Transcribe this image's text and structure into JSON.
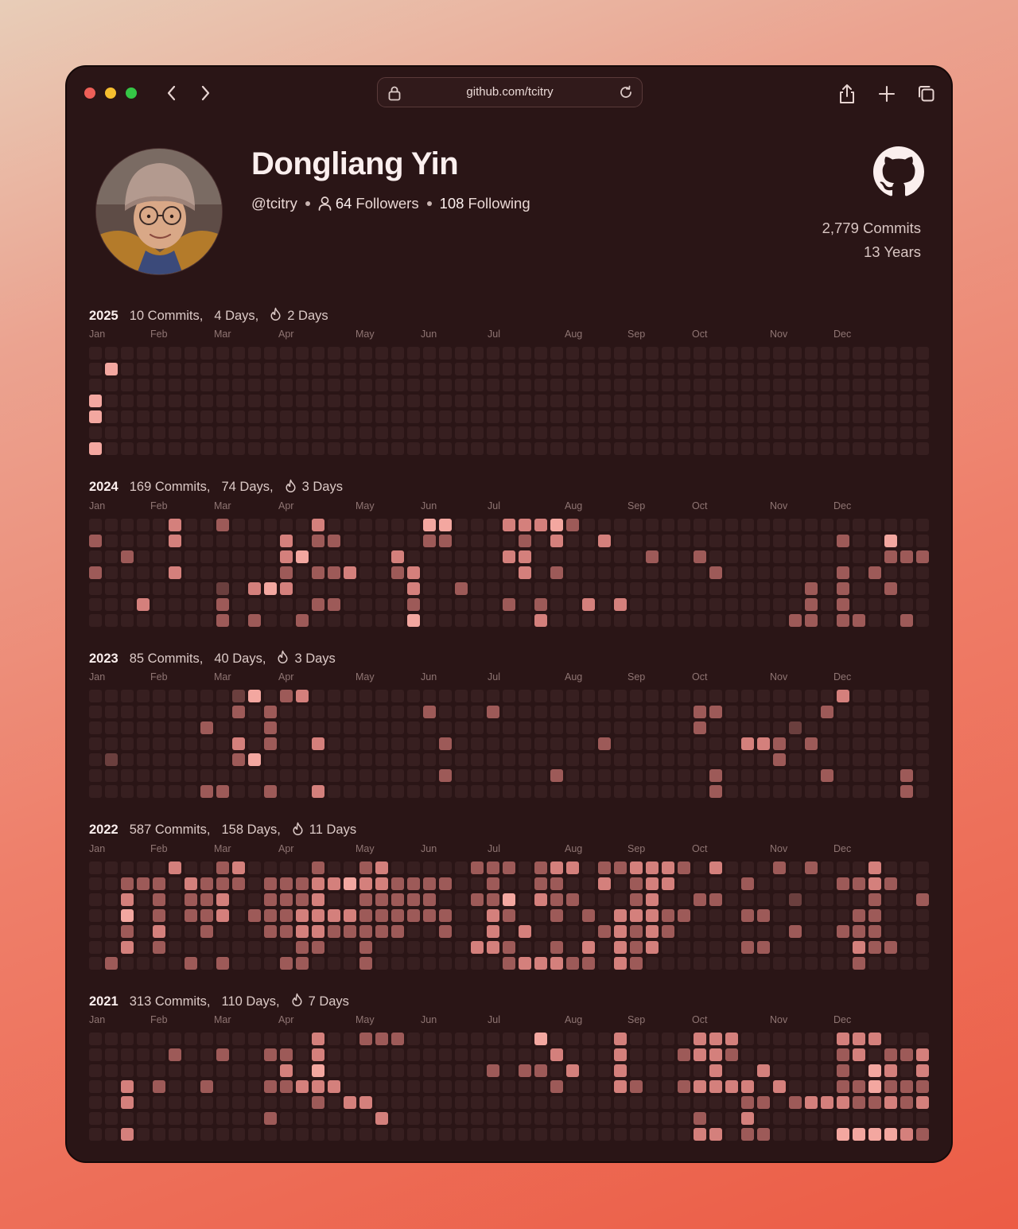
{
  "browser": {
    "url": "github.com/tcitry",
    "icons": [
      "back-icon",
      "forward-icon",
      "lock-icon",
      "reload-icon",
      "share-icon",
      "new-tab-icon",
      "tabs-icon"
    ]
  },
  "profile": {
    "name": "Dongliang Yin",
    "handle": "@tcitry",
    "followers_count": "64",
    "followers_label": "Followers",
    "following_count": "108",
    "following_label": "Following",
    "total_commits": "2,779 Commits",
    "years": "13 Years"
  },
  "colors": {
    "background": "#2a1516",
    "cell_empty": "#371f20",
    "level1": "#6b3f3e",
    "level2": "#9d5a58",
    "level3": "#d4807c",
    "level4": "#f3a7a0"
  },
  "month_labels": [
    "Jan",
    "Feb",
    "Mar",
    "Apr",
    "May",
    "Jun",
    "Jul",
    "Aug",
    "Sep",
    "Oct",
    "Nov",
    "Dec"
  ],
  "years": [
    {
      "year": "2025",
      "commits": "10 Commits,",
      "days": "4 Days,",
      "streak": "2 Days",
      "activity": [
        "00000000000000000000000000000000000000000000000000000",
        "04000000000000000000000000000000000000000000000000000",
        "00000000000000000000000000000000000000000000000000000",
        "40000000000000000000000000000000000000000000000000000",
        "40000000000000000000000000000000000000000000000000000",
        "00000000000000000000000000000000000000000000000000000",
        "40000000000000000000000000000000000000000000000000000"
      ]
    },
    {
      "year": "2024",
      "commits": "169 Commits,",
      "days": "74 Days,",
      "streak": "3 Days",
      "activity": [
        "00000300200000300000044000333420000000000000000000000",
        "20000300000030220000022000020300300000000000000200400",
        "00200000000034000003000000330000000200200000000000222",
        "20000300000020223002300000030200000000020000000202000",
        "00000000103430000000300200000000000000000000020200200",
        "00030000200000220000200000202003030000000000020200000",
        "00000000202002000000400000003000000000000000220220020"
      ]
    },
    {
      "year": "2023",
      "commits": "85 Commits,",
      "days": "40 Days,",
      "streak": "3 Days",
      "activity": [
        "00000000014023000000000000000000000000000000000300000",
        "00000000020200000000020002000000000000220000002000000",
        "00000002000200000000000000000000000000200000100000000",
        "00000000030200300000002000000000200000000332020000000",
        "01000000024000000000000000000000000000000002000000000",
        "00000000000000000000002000000200000000020000002000020",
        "00000002200200300000000000000000000000020000000000020"
      ]
    },
    {
      "year": "2022",
      "commits": "587 Commits,",
      "days": "158 Days,",
      "streak": "11 Days",
      "activity": [
        "00000300230000200230000022202330223332030002020003000020",
        "00222032220222334332222002002200302330000200000223200000",
        "00302022300222300222220022403220002300220000100002002000",
        "00402022302223333222222003200202033322000220000022000000",
        "00203002000223322222002003030000232320000000200222000020",
        "00302000000002200200000033200203032300000220000032200000",
        "02000020200022000200000000233322032000000000000020000020"
      ]
    },
    {
      "year": "2021",
      "commits": "313 Commits,",
      "days": "110 Days,",
      "streak": "7 Days",
      "activity": [
        "00000000000000300222000000004000030000333000000333000333",
        "00000200200220300000000000000300030002332000000230223200",
        "00000000000030400000000002022030030000030030000204303224",
        "00302002000223330000000000000200032002333303000224222323",
        "00300000000000203300000000000000000000000220233322323233",
        "00000000000200000030000000000000000000200300000000000000",
        "00300000000000000000000000000000000000330220000444432033"
      ]
    }
  ]
}
